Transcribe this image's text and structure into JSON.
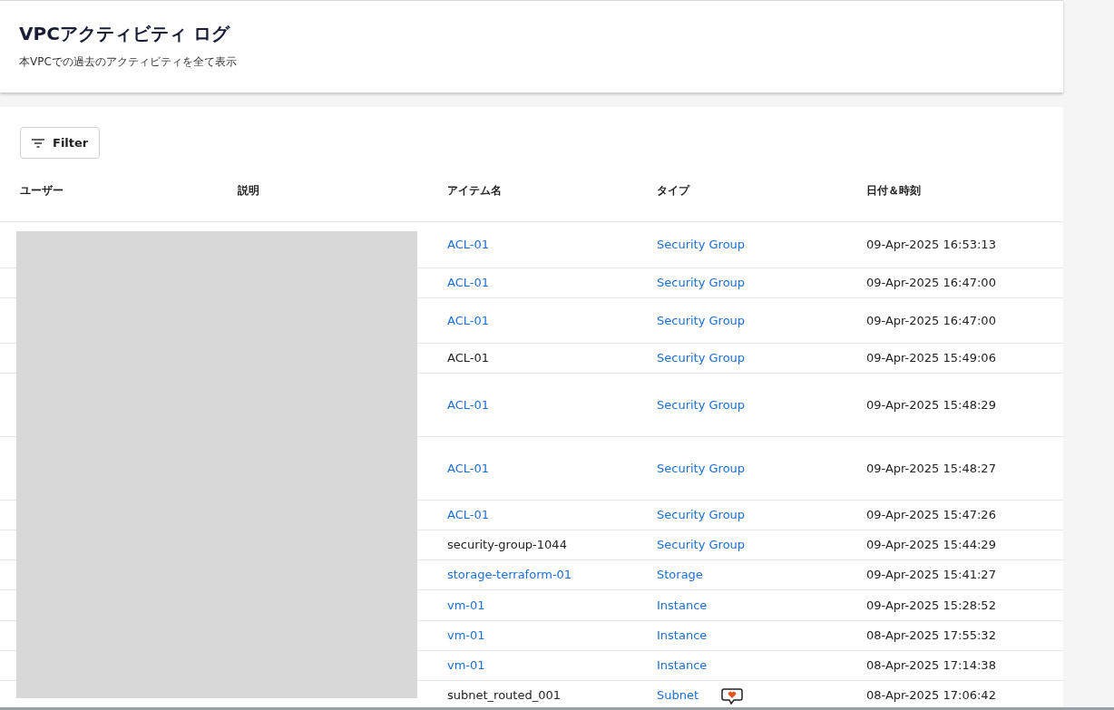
{
  "header": {
    "title": "VPCアクティビティ ログ",
    "subtitle": "本VPCでの過去のアクティビティを全て表示"
  },
  "filter_button": {
    "label": "Filter"
  },
  "table": {
    "columns": [
      "ユーザー",
      "説明",
      "アイテム名",
      "タイプ",
      "日付＆時刻"
    ],
    "rows": [
      {
        "item": "ACL-01",
        "item_link": true,
        "type": "Security Group",
        "datetime": "09-Apr-2025 16:53:13"
      },
      {
        "item": "ACL-01",
        "item_link": true,
        "type": "Security Group",
        "datetime": "09-Apr-2025 16:47:00"
      },
      {
        "item": "ACL-01",
        "item_link": true,
        "type": "Security Group",
        "datetime": "09-Apr-2025 16:47:00"
      },
      {
        "item": "ACL-01",
        "item_link": false,
        "type": "Security Group",
        "datetime": "09-Apr-2025 15:49:06"
      },
      {
        "item": "ACL-01",
        "item_link": true,
        "type": "Security Group",
        "datetime": "09-Apr-2025 15:48:29"
      },
      {
        "item": "ACL-01",
        "item_link": true,
        "type": "Security Group",
        "datetime": "09-Apr-2025 15:48:27"
      },
      {
        "item": "ACL-01",
        "item_link": true,
        "type": "Security Group",
        "datetime": "09-Apr-2025 15:47:26"
      },
      {
        "item": "security-group-1044",
        "item_link": false,
        "type": "Security Group",
        "datetime": "09-Apr-2025 15:44:29"
      },
      {
        "item": "storage-terraform-01",
        "item_link": true,
        "type": "Storage",
        "datetime": "09-Apr-2025 15:41:27"
      },
      {
        "item": "vm-01",
        "item_link": true,
        "type": "Instance",
        "datetime": "09-Apr-2025 15:28:52"
      },
      {
        "item": "vm-01",
        "item_link": true,
        "type": "Instance",
        "datetime": "08-Apr-2025 17:55:32"
      },
      {
        "item": "vm-01",
        "item_link": true,
        "type": "Instance",
        "datetime": "08-Apr-2025 17:14:38"
      },
      {
        "item": "subnet_routed_001",
        "item_link": false,
        "type": "Subnet",
        "datetime": "08-Apr-2025 17:06:42"
      }
    ]
  }
}
